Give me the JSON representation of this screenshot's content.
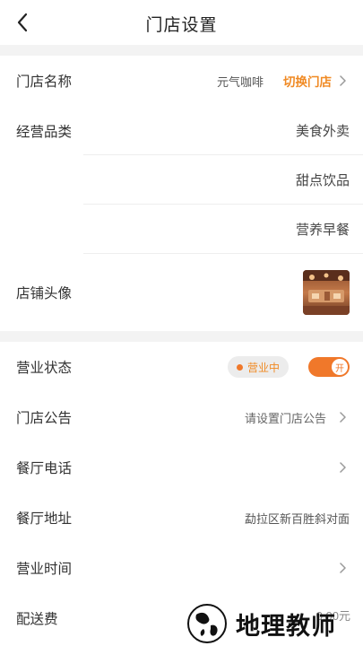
{
  "header": {
    "title": "门店设置",
    "back_icon": "chevron-left-icon"
  },
  "section1": {
    "store": {
      "label": "门店名称",
      "value": "元气咖啡",
      "action": "切换门店"
    },
    "categories": {
      "label": "经营品类",
      "items": [
        "美食外卖",
        "甜点饮品",
        "营养早餐"
      ]
    },
    "avatar": {
      "label": "店铺头像"
    }
  },
  "section2": {
    "status": {
      "label": "营业状态",
      "pill_text": "营业中",
      "toggle_text": "开"
    },
    "notice": {
      "label": "门店公告",
      "placeholder": "请设置门店公告"
    },
    "phone": {
      "label": "餐厅电话"
    },
    "address": {
      "label": "餐厅地址",
      "value": "勐拉区新百胜斜对面"
    },
    "hours": {
      "label": "营业时间"
    },
    "delivery_fee": {
      "label": "配送费",
      "value": "0.00元"
    }
  },
  "watermark": {
    "text": "地理教师"
  },
  "colors": {
    "accent": "#f08a24",
    "toggle": "#f0782a",
    "gap": "#f3f3f3"
  }
}
